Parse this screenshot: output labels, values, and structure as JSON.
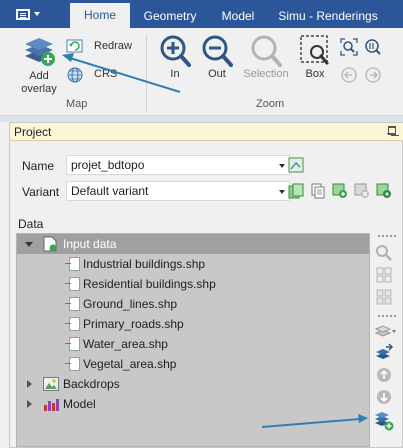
{
  "ribbon_tabs": {
    "home": "Home",
    "geometry": "Geometry",
    "model": "Model",
    "simu": "Simu - Renderings"
  },
  "map_group": {
    "label": "Map",
    "add_overlay": "Add\noverlay",
    "redraw": "Redraw",
    "crs": "CRS"
  },
  "zoom_group": {
    "label": "Zoom",
    "in": "In",
    "out": "Out",
    "selection": "Selection",
    "box": "Box"
  },
  "project_panel": {
    "title": "Project",
    "name_label": "Name",
    "name_value": "projet_bdtopo",
    "variant_label": "Variant",
    "variant_value": "Default variant",
    "data_label": "Data"
  },
  "tree": {
    "input_data": "Input data",
    "layers": [
      "Industrial buildings.shp",
      "Residential buildings.shp",
      "Ground_lines.shp",
      "Primary_roads.shp",
      "Water_area.shp",
      "Vegetal_area.shp"
    ],
    "backdrops": "Backdrops",
    "model": "Model"
  },
  "colors": {
    "ribbon_blue": "#2b579a",
    "panel_title_bg": "#fcf6d6",
    "accent_green": "#3aa655",
    "annotation_arrow": "#2f7fb5"
  }
}
